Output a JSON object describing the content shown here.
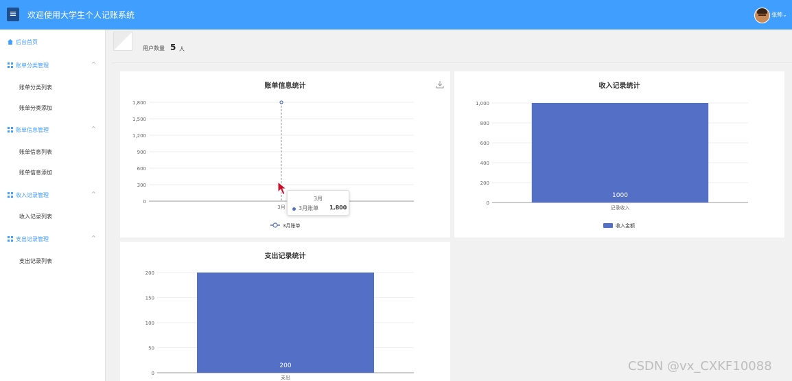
{
  "header": {
    "title": "欢迎使用大学生个人记账系统",
    "menu_icon": "≡",
    "user": "张帅",
    "user_caret": "⌄"
  },
  "sidebar": {
    "home": "后台首页",
    "groups": [
      {
        "label": "账单分类管理",
        "items": [
          "账单分类列表",
          "账单分类添加"
        ]
      },
      {
        "label": "账单信息管理",
        "items": [
          "账单信息列表",
          "账单信息添加"
        ]
      },
      {
        "label": "收入记录管理",
        "items": [
          "收入记录列表"
        ]
      },
      {
        "label": "支出记录管理",
        "items": [
          "支出记录列表"
        ]
      }
    ],
    "chevron": "^"
  },
  "user_count": {
    "label": "用户数量",
    "value": "5",
    "unit": "人"
  },
  "charts": {
    "bill": {
      "title": "账单信息统计"
    },
    "income": {
      "title": "收入记录统计"
    },
    "expense": {
      "title": "支出记录统计"
    }
  },
  "tooltip": {
    "title": "3月",
    "name": "3月账单",
    "value": "1,800"
  },
  "watermark": "CSDN @vx_CXKF10088",
  "chart_data": [
    {
      "type": "line",
      "title": "账单信息统计",
      "x": [
        "3月"
      ],
      "series": [
        {
          "name": "3月账单",
          "values": [
            1800
          ]
        }
      ],
      "yticks": [
        "0",
        "300",
        "600",
        "900",
        "1,200",
        "1,500",
        "1,800"
      ],
      "ylim": [
        0,
        1800
      ],
      "legend": "bottom",
      "color": "#5470c6"
    },
    {
      "type": "bar",
      "title": "收入记录统计",
      "categories": [
        "记录收入"
      ],
      "series": [
        {
          "name": "收入金额",
          "values": [
            1000
          ]
        }
      ],
      "data_labels": [
        "1000"
      ],
      "yticks": [
        "0",
        "200",
        "400",
        "600",
        "800",
        "1,000"
      ],
      "ylim": [
        0,
        1000
      ],
      "legend": "bottom",
      "color": "#5470c6"
    },
    {
      "type": "bar",
      "title": "支出记录统计",
      "categories": [
        "支出"
      ],
      "values": [
        200
      ],
      "data_labels": [
        "200"
      ],
      "yticks": [
        "0",
        "50",
        "100",
        "150",
        "200"
      ],
      "ylim": [
        0,
        200
      ],
      "color": "#5470c6"
    }
  ]
}
